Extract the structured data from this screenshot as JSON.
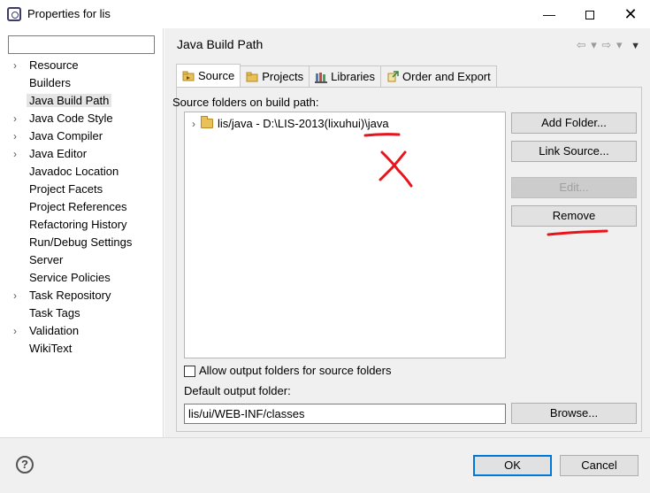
{
  "window": {
    "title": "Properties for lis",
    "min_glyph": "—",
    "close_glyph": "✕"
  },
  "left": {
    "filter_value": "",
    "items": [
      {
        "label": "Resource",
        "expandable": true
      },
      {
        "label": "Builders",
        "expandable": false
      },
      {
        "label": "Java Build Path",
        "expandable": false,
        "selected": true
      },
      {
        "label": "Java Code Style",
        "expandable": true
      },
      {
        "label": "Java Compiler",
        "expandable": true
      },
      {
        "label": "Java Editor",
        "expandable": true
      },
      {
        "label": "Javadoc Location",
        "expandable": false
      },
      {
        "label": "Project Facets",
        "expandable": false
      },
      {
        "label": "Project References",
        "expandable": false
      },
      {
        "label": "Refactoring History",
        "expandable": false
      },
      {
        "label": "Run/Debug Settings",
        "expandable": false
      },
      {
        "label": "Server",
        "expandable": false
      },
      {
        "label": "Service Policies",
        "expandable": false
      },
      {
        "label": "Task Repository",
        "expandable": true
      },
      {
        "label": "Task Tags",
        "expandable": false
      },
      {
        "label": "Validation",
        "expandable": true
      },
      {
        "label": "WikiText",
        "expandable": false
      }
    ]
  },
  "main": {
    "title": "Java Build Path",
    "nav": {
      "back": "⇦",
      "forward": "⇨",
      "dropdown": "▾",
      "menu": "▼"
    },
    "tabs": [
      {
        "label": "Source",
        "active": true
      },
      {
        "label": "Projects",
        "active": false
      },
      {
        "label": "Libraries",
        "active": false
      },
      {
        "label": "Order and Export",
        "active": false
      }
    ],
    "source_label": "Source folders on build path:",
    "source_entry": "lis/java - D:\\LIS-2013(lixuhui)\\java",
    "buttons": {
      "add_folder": "Add Folder...",
      "link_source": "Link Source...",
      "edit": "Edit...",
      "remove": "Remove"
    },
    "allow_output_label": "Allow output folders for source folders",
    "allow_output_checked": false,
    "default_output_label": "Default output folder:",
    "default_output_value": "lis/ui/WEB-INF/classes",
    "browse": "Browse..."
  },
  "footer": {
    "help_glyph": "?",
    "ok": "OK",
    "cancel": "Cancel"
  },
  "colors": {
    "annotation": "#e8141c",
    "accent_border": "#0078d7"
  }
}
